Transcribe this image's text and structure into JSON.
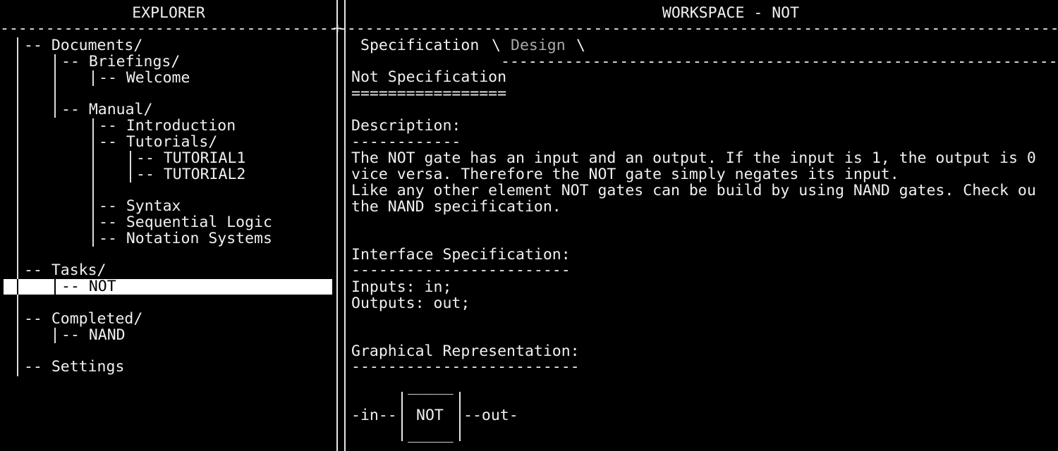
{
  "explorer": {
    "header": "EXPLORER",
    "tree": {
      "documents": "-- Documents/",
      "briefings": "-- Briefings/",
      "welcome": "-- Welcome",
      "manual": "-- Manual/",
      "introduction": "-- Introduction",
      "tutorials": "-- Tutorials/",
      "tutorial1": "-- TUTORIAL1",
      "tutorial2": "-- TUTORIAL2",
      "syntax": "-- Syntax",
      "sequential_logic": "-- Sequential Logic",
      "notation_systems": "-- Notation Systems",
      "tasks": "-- Tasks/",
      "not": "-- NOT",
      "completed": "-- Completed/",
      "nand": "-- NAND",
      "settings": "-- Settings"
    },
    "selected_item": "NOT"
  },
  "workspace": {
    "header": "WORKSPACE - NOT",
    "tabs": {
      "specification": "Specification",
      "sep1": "\\",
      "design": "Design",
      "sep2": "\\"
    },
    "tab_underline": "-------------------------------------------------------------------------------------",
    "title": "Not Specification",
    "title_underline": "=================",
    "description_heading": "Description:",
    "description_underline": "------------",
    "description_lines": [
      "The NOT gate has an input and an output. If the input is 1, the output is 0",
      "vice versa. Therefore the NOT gate simply negates its input.",
      "Like any other element NOT gates can be build by using NAND gates. Check ou",
      "the NAND specification."
    ],
    "interface_heading": "Interface Specification:",
    "interface_underline": "------------------------",
    "inputs": "Inputs: in;",
    "outputs": "Outputs: out;",
    "graphical_heading": "Graphical Representation:",
    "graphical_underline": "-------------------------",
    "diagram": {
      "top": "_____",
      "bottom": "_____",
      "gate_label": "NOT",
      "input": "-in--",
      "output": "--out-"
    }
  },
  "separators": {
    "divider_dashes": "--------------------------------------------------------------------------------------------------------------------------------------------------",
    "junction": "+",
    "top_mark": "||"
  },
  "colors": {
    "background": "#000000",
    "foreground": "#f0f0f0",
    "selection_bg": "#ffffff",
    "selection_fg": "#000000"
  }
}
